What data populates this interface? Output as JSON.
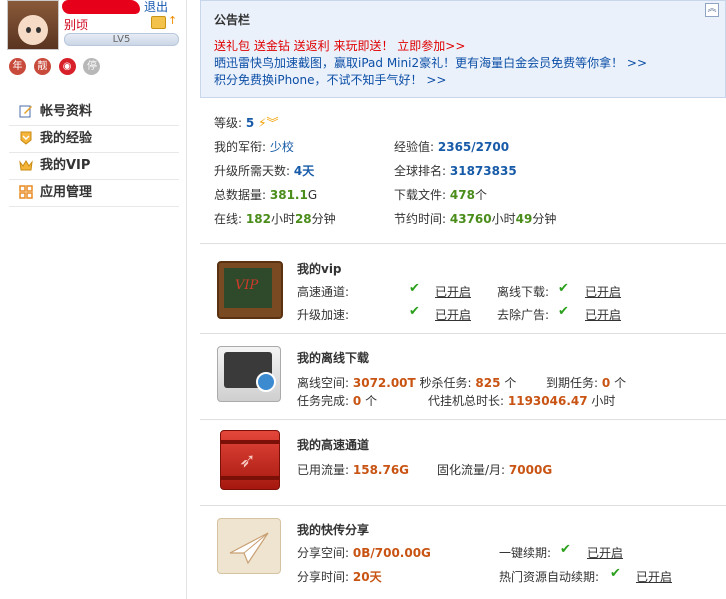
{
  "user": {
    "logout": "退出",
    "alias": "别顷",
    "level": "LV5",
    "badges": [
      "年",
      "靓",
      "",
      "停"
    ]
  },
  "menu": [
    {
      "label": "帐号资料",
      "icon": "edit-icon"
    },
    {
      "label": "我的经验",
      "icon": "experience-icon"
    },
    {
      "label": "我的VIP",
      "icon": "crown-icon"
    },
    {
      "label": "应用管理",
      "icon": "apps-icon"
    }
  ],
  "notice": {
    "title": "公告栏",
    "line1_red": "送礼包 送金钻 送返利 来玩即送！",
    "line1_link": "立即参加>>",
    "line2": "晒迅雷快鸟加速截图，赢取iPad Mini2豪礼！更有海量白金会员免费等你拿！ >>",
    "line3": "积分免费换iPhone，不试不知手气好！ >>"
  },
  "stats": {
    "level_label": "等级:",
    "level_value": "5",
    "rank_label": "我的军衔:",
    "rank_value": "少校",
    "exp_label": "经验值:",
    "exp_value": "2365/2700",
    "upgrade_label": "升级所需天数:",
    "upgrade_value": "4天",
    "global_label": "全球排名:",
    "global_value": "31873835",
    "total_label": "总数据量:",
    "total_value": "381.1",
    "total_unit": "G",
    "files_label": "下载文件:",
    "files_value": "478",
    "files_unit": "个",
    "online_label": "在线:",
    "online_h": "182",
    "online_h_unit": "小时",
    "online_m": "28",
    "online_m_unit": "分钟",
    "save_label": "节约时间:",
    "save_h": "43760",
    "save_h_unit": "小时",
    "save_m": "49",
    "save_m_unit": "分钟"
  },
  "vip": {
    "title": "我的vip",
    "speed_label": "高速通道:",
    "speed_status": "已开启",
    "offline_label": "离线下载:",
    "offline_status": "已开启",
    "upgrade_label": "升级加速:",
    "upgrade_status": "已开启",
    "ads_label": "去除广告:",
    "ads_status": "已开启"
  },
  "offline": {
    "title": "我的离线下载",
    "space_label": "离线空间:",
    "space_value": "3072.00T",
    "instant_label": "秒杀任务:",
    "instant_value": "825",
    "instant_unit": "个",
    "expire_label": "到期任务:",
    "expire_value": "0",
    "expire_unit": "个",
    "done_label": "任务完成:",
    "done_value": "0",
    "done_unit": "个",
    "proxy_label": "代挂机总时长:",
    "proxy_value": "1193046.47",
    "proxy_unit": "小时"
  },
  "highspeed": {
    "title": "我的高速通道",
    "used_label": "已用流量:",
    "used_value": "158.76G",
    "fixed_label": "固化流量/月:",
    "fixed_value": "7000G"
  },
  "share": {
    "title": "我的快传分享",
    "space_label": "分享空间:",
    "space_value": "0B/700.00G",
    "renew_label": "一键续期:",
    "renew_status": "已开启",
    "time_label": "分享时间:",
    "time_value": "20天",
    "auto_label": "热门资源自动续期:",
    "auto_status": "已开启"
  },
  "colors": {
    "accent_blue": "#175ba8",
    "green": "#4a8d1a",
    "orange": "#c85312",
    "red": "#e00000",
    "check": "#2aa01c"
  }
}
